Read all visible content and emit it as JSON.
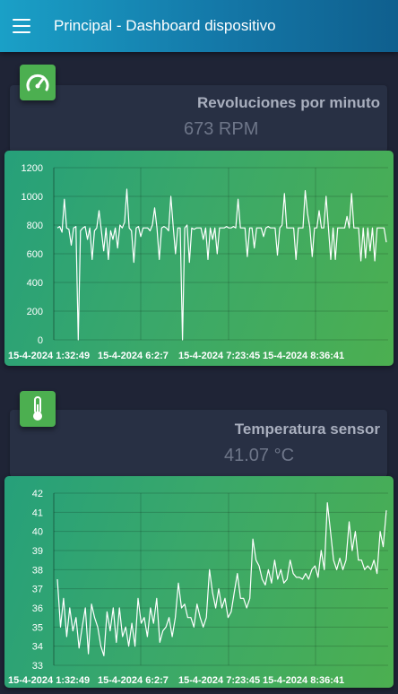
{
  "topbar": {
    "title": "Principal - Dashboard dispositivo"
  },
  "cards": [
    {
      "icon": "speedometer-icon",
      "title": "Revoluciones por minuto",
      "value": "673 RPM"
    },
    {
      "icon": "thermometer-icon",
      "title": "Temperatura sensor",
      "value": "41.07 °C"
    }
  ],
  "colors": {
    "topbar": "#1478a8",
    "card_bg": "#283044",
    "page_bg": "#1f2436",
    "chart_green": "#4caf50",
    "line": "#ffffff"
  },
  "chart_data": [
    {
      "type": "line",
      "title": "",
      "xlabel": "",
      "ylabel": "",
      "ylim": [
        0,
        1200
      ],
      "yticks": [
        "1200",
        "1000",
        "800",
        "600",
        "400",
        "200",
        "0"
      ],
      "xtick_labels": [
        "15-4-2024 1:32:49",
        "15-4-2024 6:2:7",
        "15-4-2024 7:23:45",
        "15-4-2024 8:36:41"
      ],
      "grid": true,
      "series": [
        {
          "values": [
            780,
            790,
            750,
            980,
            780,
            770,
            660,
            780,
            790,
            0,
            760,
            780,
            790,
            700,
            780,
            560,
            760,
            780,
            900,
            760,
            620,
            780,
            560,
            760,
            700,
            780,
            640,
            800,
            780,
            820,
            1050,
            780,
            760,
            540,
            780,
            790,
            720,
            780,
            780,
            780,
            760,
            800,
            920,
            780,
            560,
            780,
            790,
            780,
            760,
            1000,
            790,
            600,
            780,
            780,
            0,
            780,
            800,
            540,
            780,
            770,
            780,
            780,
            780,
            700,
            780,
            560,
            780,
            700,
            780,
            600,
            780,
            780,
            780,
            790,
            780,
            780,
            790,
            780,
            980,
            780,
            780,
            780,
            580,
            780,
            780,
            640,
            780,
            780,
            780,
            720,
            780,
            790,
            780,
            780,
            780,
            590,
            780,
            800,
            1020,
            780,
            780,
            780,
            780,
            560,
            780,
            780,
            780,
            1040,
            880,
            780,
            580,
            780,
            780,
            900,
            780,
            780,
            1000,
            780,
            560,
            780,
            560,
            780,
            780,
            780,
            780,
            860,
            780,
            1020,
            780,
            780,
            780,
            550,
            780,
            570,
            780,
            620,
            780,
            550,
            780,
            780,
            780,
            780,
            680
          ]
        }
      ]
    },
    {
      "type": "line",
      "title": "",
      "xlabel": "",
      "ylabel": "",
      "ylim": [
        33,
        42
      ],
      "yticks": [
        "42",
        "41",
        "40",
        "39",
        "38",
        "37",
        "36",
        "35",
        "34",
        "33"
      ],
      "xtick_labels": [
        "15-4-2024 1:32:49",
        "15-4-2024 6:2:7",
        "15-4-2024 7:23:45",
        "15-4-2024 8:36:41"
      ],
      "grid": true,
      "series": [
        {
          "values": [
            37.5,
            35.0,
            36.5,
            34.5,
            36.0,
            34.8,
            35.5,
            33.9,
            35.0,
            36.0,
            33.6,
            36.2,
            35.5,
            35.0,
            34.0,
            33.5,
            35.8,
            34.8,
            36.0,
            34.2,
            36.0,
            34.5,
            35.0,
            34.0,
            35.2,
            34.0,
            36.5,
            35.2,
            35.5,
            34.5,
            36.0,
            35.2,
            36.5,
            34.2,
            34.8,
            35.0,
            35.5,
            34.5,
            35.5,
            37.3,
            36.0,
            36.2,
            35.5,
            35.5,
            35.0,
            36.2,
            35.5,
            35.0,
            35.5,
            38.0,
            36.8,
            36.0,
            37.0,
            36.0,
            36.5,
            35.5,
            35.8,
            36.8,
            37.8,
            36.5,
            36.5,
            36.0,
            36.5,
            39.6,
            38.5,
            38.2,
            37.5,
            37.2,
            38.0,
            37.3,
            38.5,
            37.5,
            38.0,
            37.3,
            37.5,
            38.5,
            37.8,
            37.6,
            37.6,
            37.5,
            37.8,
            37.5,
            38.0,
            38.2,
            37.6,
            39.0,
            38.0,
            41.5,
            40.0,
            38.5,
            38.0,
            38.6,
            38.0,
            38.5,
            40.5,
            39.0,
            40.0,
            38.5,
            38.5,
            38.0,
            38.2,
            38.0,
            38.5,
            37.8,
            40.0,
            39.2,
            41.1
          ]
        }
      ]
    }
  ]
}
